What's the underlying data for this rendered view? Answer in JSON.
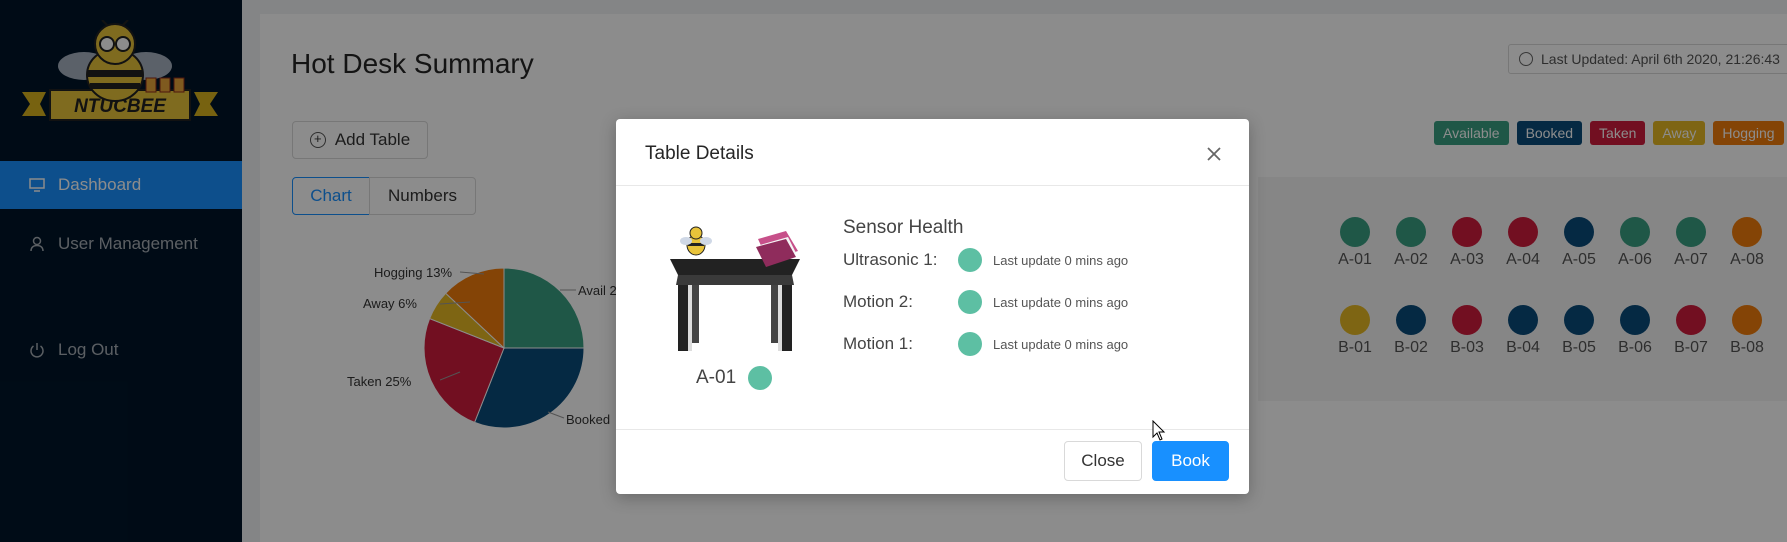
{
  "sidebar": {
    "logo_text": "NTUCBEE",
    "items": [
      {
        "label": "Dashboard",
        "icon": "monitor-icon",
        "active": true
      },
      {
        "label": "User Management",
        "icon": "user-icon",
        "active": false
      },
      {
        "label": "Log Out",
        "icon": "power-icon",
        "active": false
      }
    ]
  },
  "header": {
    "title": "Hot Desk Summary",
    "last_updated": "Last Updated: April 6th 2020, 21:26:43"
  },
  "toolbar": {
    "add_table_label": "Add Table",
    "tabs": [
      "Chart",
      "Numbers"
    ],
    "active_tab": "Chart"
  },
  "legend": [
    {
      "label": "Available",
      "color": "#3a9e82"
    },
    {
      "label": "Booked",
      "color": "#0a4c7a"
    },
    {
      "label": "Taken",
      "color": "#cf1d3c"
    },
    {
      "label": "Away",
      "color": "#e6b823"
    },
    {
      "label": "Hogging",
      "color": "#f07d0b"
    }
  ],
  "pie_labels": {
    "hogging": "Hogging 13%",
    "away": "Away 6%",
    "taken": "Taken 25%",
    "avail": "Avail 2",
    "booked": "Booked"
  },
  "chart_data": {
    "type": "pie",
    "categories": [
      "Available",
      "Booked",
      "Taken",
      "Away",
      "Hogging"
    ],
    "values": [
      25,
      31,
      25,
      6,
      13
    ],
    "colors": [
      "#3a9e82",
      "#0a4c7a",
      "#cf1d3c",
      "#e6b823",
      "#f07d0b"
    ]
  },
  "desks": {
    "row_a": [
      {
        "id": "A-01",
        "color": "#3a9e82"
      },
      {
        "id": "A-02",
        "color": "#3a9e82"
      },
      {
        "id": "A-03",
        "color": "#cf1d3c"
      },
      {
        "id": "A-04",
        "color": "#cf1d3c"
      },
      {
        "id": "A-05",
        "color": "#0a4c7a"
      },
      {
        "id": "A-06",
        "color": "#3a9e82"
      },
      {
        "id": "A-07",
        "color": "#3a9e82"
      },
      {
        "id": "A-08",
        "color": "#f07d0b"
      }
    ],
    "row_b": [
      {
        "id": "B-01",
        "color": "#e6b823"
      },
      {
        "id": "B-02",
        "color": "#0a4c7a"
      },
      {
        "id": "B-03",
        "color": "#cf1d3c"
      },
      {
        "id": "B-04",
        "color": "#0a4c7a"
      },
      {
        "id": "B-05",
        "color": "#0a4c7a"
      },
      {
        "id": "B-06",
        "color": "#0a4c7a"
      },
      {
        "id": "B-07",
        "color": "#cf1d3c"
      },
      {
        "id": "B-08",
        "color": "#f07d0b"
      }
    ]
  },
  "modal": {
    "title": "Table Details",
    "sensor_title": "Sensor Health",
    "table_id": "A-01",
    "table_status_color": "#5dbfa3",
    "sensors": [
      {
        "name": "Ultrasonic 1:",
        "update": "Last update 0 mins ago",
        "color": "#5dbfa3"
      },
      {
        "name": "Motion 2:",
        "update": "Last update 0 mins ago",
        "color": "#5dbfa3"
      },
      {
        "name": "Motion 1:",
        "update": "Last update 0 mins ago",
        "color": "#5dbfa3"
      }
    ],
    "close_label": "Close",
    "book_label": "Book"
  }
}
